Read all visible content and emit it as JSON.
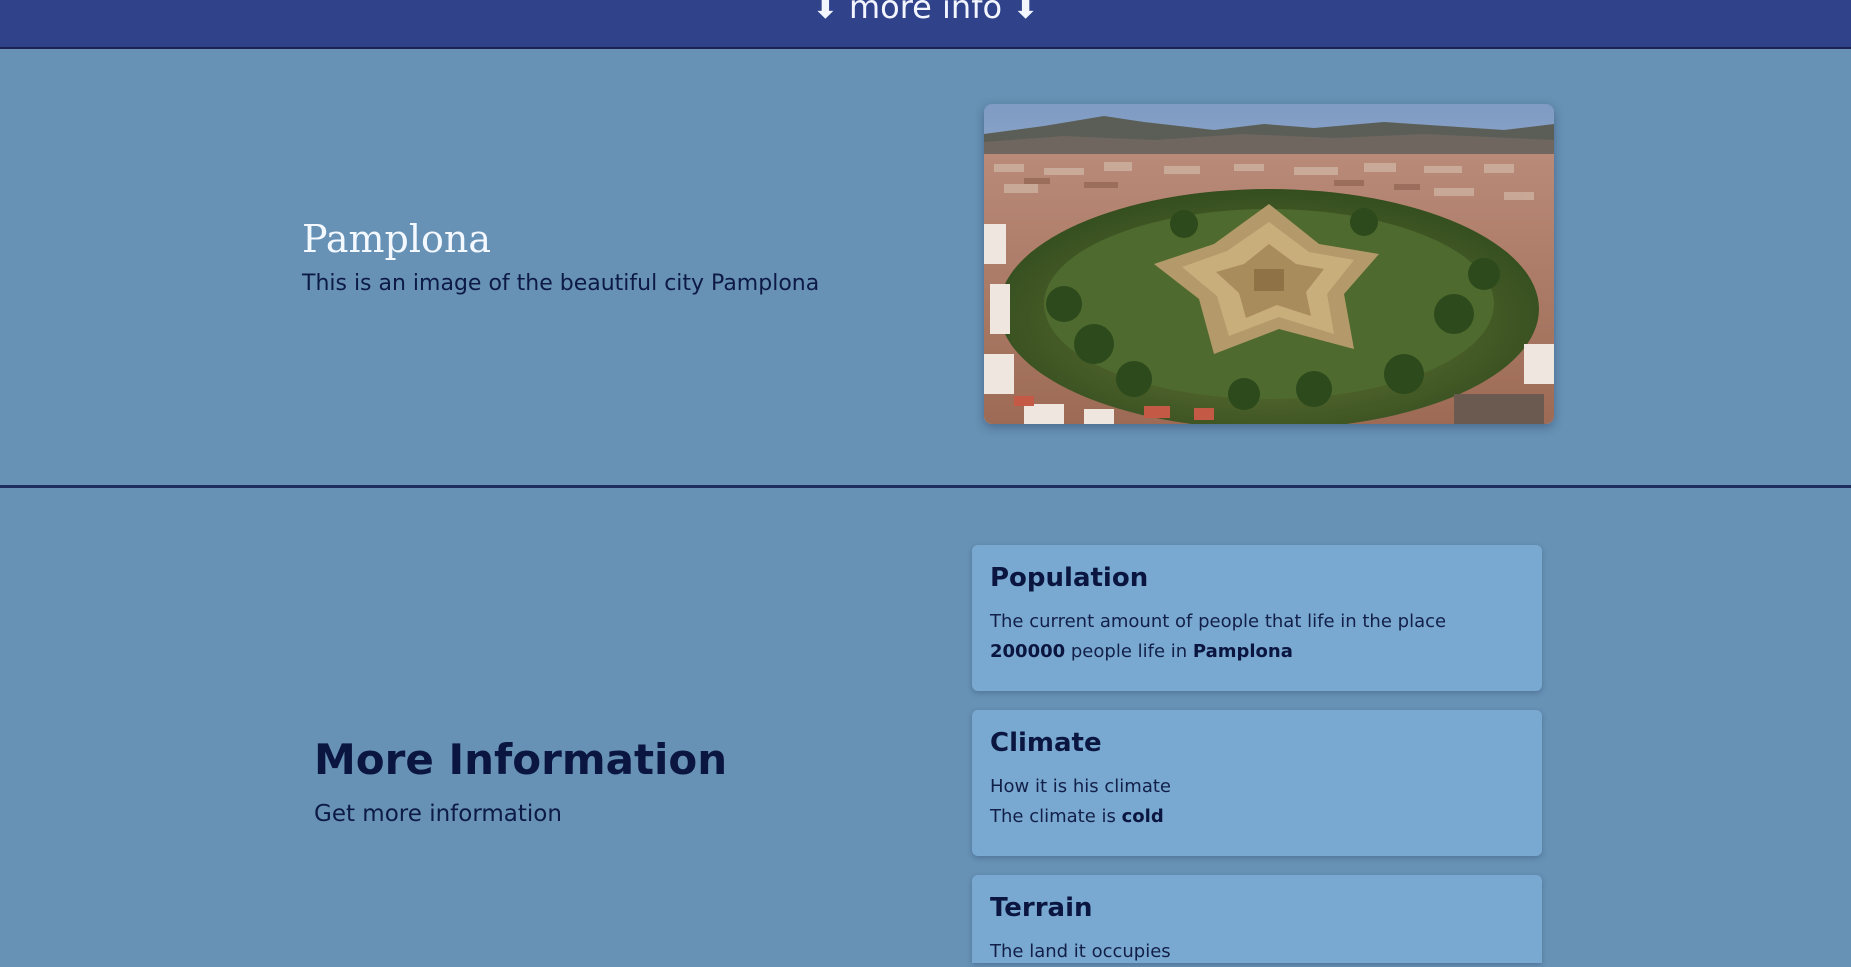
{
  "header": {
    "more_info_label": "⬇ more info ⬇"
  },
  "hero": {
    "title": "Pamplona",
    "description": "This is an image of the beautiful city Pamplona",
    "image_alt": "Aerial view of Pamplona citadel"
  },
  "info": {
    "title": "More Information",
    "subtitle": "Get more information"
  },
  "cards": [
    {
      "title": "Population",
      "description": "The current amount of people that life in the place",
      "value": "200000",
      "middle_text": " people life in ",
      "place": "Pamplona"
    },
    {
      "title": "Climate",
      "description": "How it is his climate",
      "prefix": "The climate is ",
      "value": "cold"
    },
    {
      "title": "Terrain",
      "description": "The land it occupies"
    }
  ],
  "colors": {
    "page_background": "#6792b5",
    "header_background": "#30428a",
    "card_background": "#79a8d0",
    "dark_text": "#0b1640"
  }
}
